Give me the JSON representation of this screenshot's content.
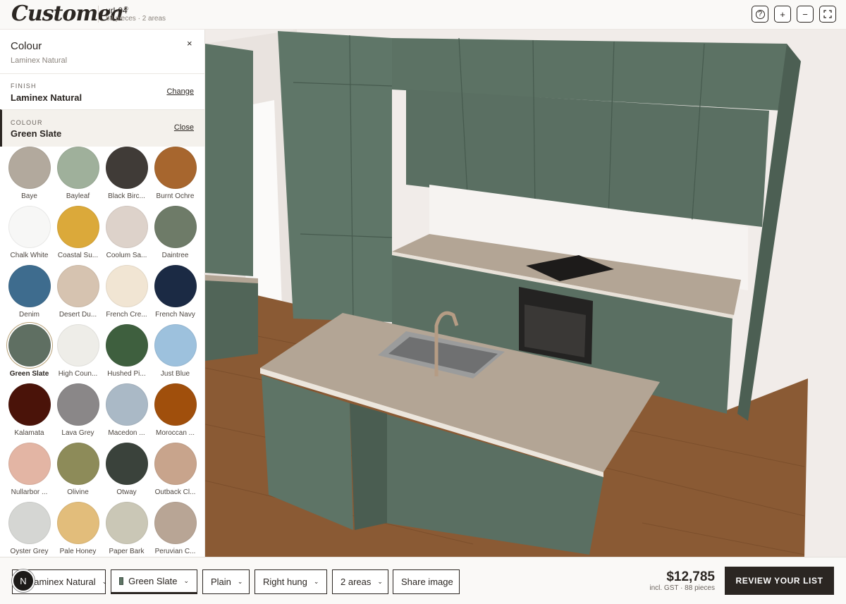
{
  "brand": {
    "logo_text": "Customea",
    "logo_mark": "®"
  },
  "project": {
    "title": "url-04",
    "subtitle": "88 pieces · 2 areas"
  },
  "header_buttons": [
    {
      "icon": "help-icon",
      "glyph": "?"
    },
    {
      "icon": "zoom-in-icon",
      "glyph": "+"
    },
    {
      "icon": "zoom-out-icon",
      "glyph": "−"
    },
    {
      "icon": "fullscreen-icon",
      "glyph": "⛶"
    }
  ],
  "panel": {
    "title": "Colour",
    "subtitle": "Laminex Natural",
    "close_glyph": "×",
    "finish": {
      "label": "FINISH",
      "value": "Laminex Natural",
      "action": "Change"
    },
    "colour": {
      "label": "COLOUR",
      "value": "Green Slate",
      "action": "Close"
    },
    "swatches": [
      {
        "name": "Baye",
        "color": "#b2a99d"
      },
      {
        "name": "Bayleaf",
        "color": "#9fb09b"
      },
      {
        "name": "Black Birc...",
        "color": "#403b37"
      },
      {
        "name": "Burnt Ochre",
        "color": "#a7662e"
      },
      {
        "name": "Chalk White",
        "color": "#f7f7f6"
      },
      {
        "name": "Coastal Su...",
        "color": "#dba93a"
      },
      {
        "name": "Coolum Sa...",
        "color": "#ddd2ca"
      },
      {
        "name": "Daintree",
        "color": "#6e7b68"
      },
      {
        "name": "Denim",
        "color": "#3e6c8e"
      },
      {
        "name": "Desert Du...",
        "color": "#d6c3b0"
      },
      {
        "name": "French Cre...",
        "color": "#f1e5d3"
      },
      {
        "name": "French Navy",
        "color": "#1b2a44"
      },
      {
        "name": "Green Slate",
        "color": "#5f6f62",
        "selected": true
      },
      {
        "name": "High Coun...",
        "color": "#eeede8"
      },
      {
        "name": "Hushed Pi...",
        "color": "#3e5f3e"
      },
      {
        "name": "Just Blue",
        "color": "#9dc1dd"
      },
      {
        "name": "Kalamata",
        "color": "#4a1309"
      },
      {
        "name": "Lava Grey",
        "color": "#8a8788"
      },
      {
        "name": "Macedon ...",
        "color": "#aab9c6"
      },
      {
        "name": "Moroccan ...",
        "color": "#a04f0c"
      },
      {
        "name": "Nullarbor ...",
        "color": "#e3b5a4"
      },
      {
        "name": "Olivine",
        "color": "#8d8b59"
      },
      {
        "name": "Otway",
        "color": "#3a423b"
      },
      {
        "name": "Outback Cl...",
        "color": "#c8a48c"
      },
      {
        "name": "Oyster Grey",
        "color": "#d5d6d3"
      },
      {
        "name": "Pale Honey",
        "color": "#e2bd7b"
      },
      {
        "name": "Paper Bark",
        "color": "#cac7b6"
      },
      {
        "name": "Peruvian C...",
        "color": "#b8a595"
      }
    ]
  },
  "bottom_bar": {
    "avatar_letter": "N",
    "finish_label": "Laminex Natural",
    "colour_label": "Green Slate",
    "colour_swatch": "#5e7565",
    "style_label": "Plain",
    "hinge_label": "Right hung",
    "areas_label": "2 areas",
    "share_label": "Share image",
    "price": "$12,785",
    "price_sub": "incl. GST · 88 pieces",
    "review_label": "REVIEW YOUR LIST"
  },
  "scene": {
    "cabinet_color": "#5c7264",
    "benchtop_color": "#b3a595",
    "floor_color": "#8a5a34",
    "wall_color": "#efebe8"
  }
}
